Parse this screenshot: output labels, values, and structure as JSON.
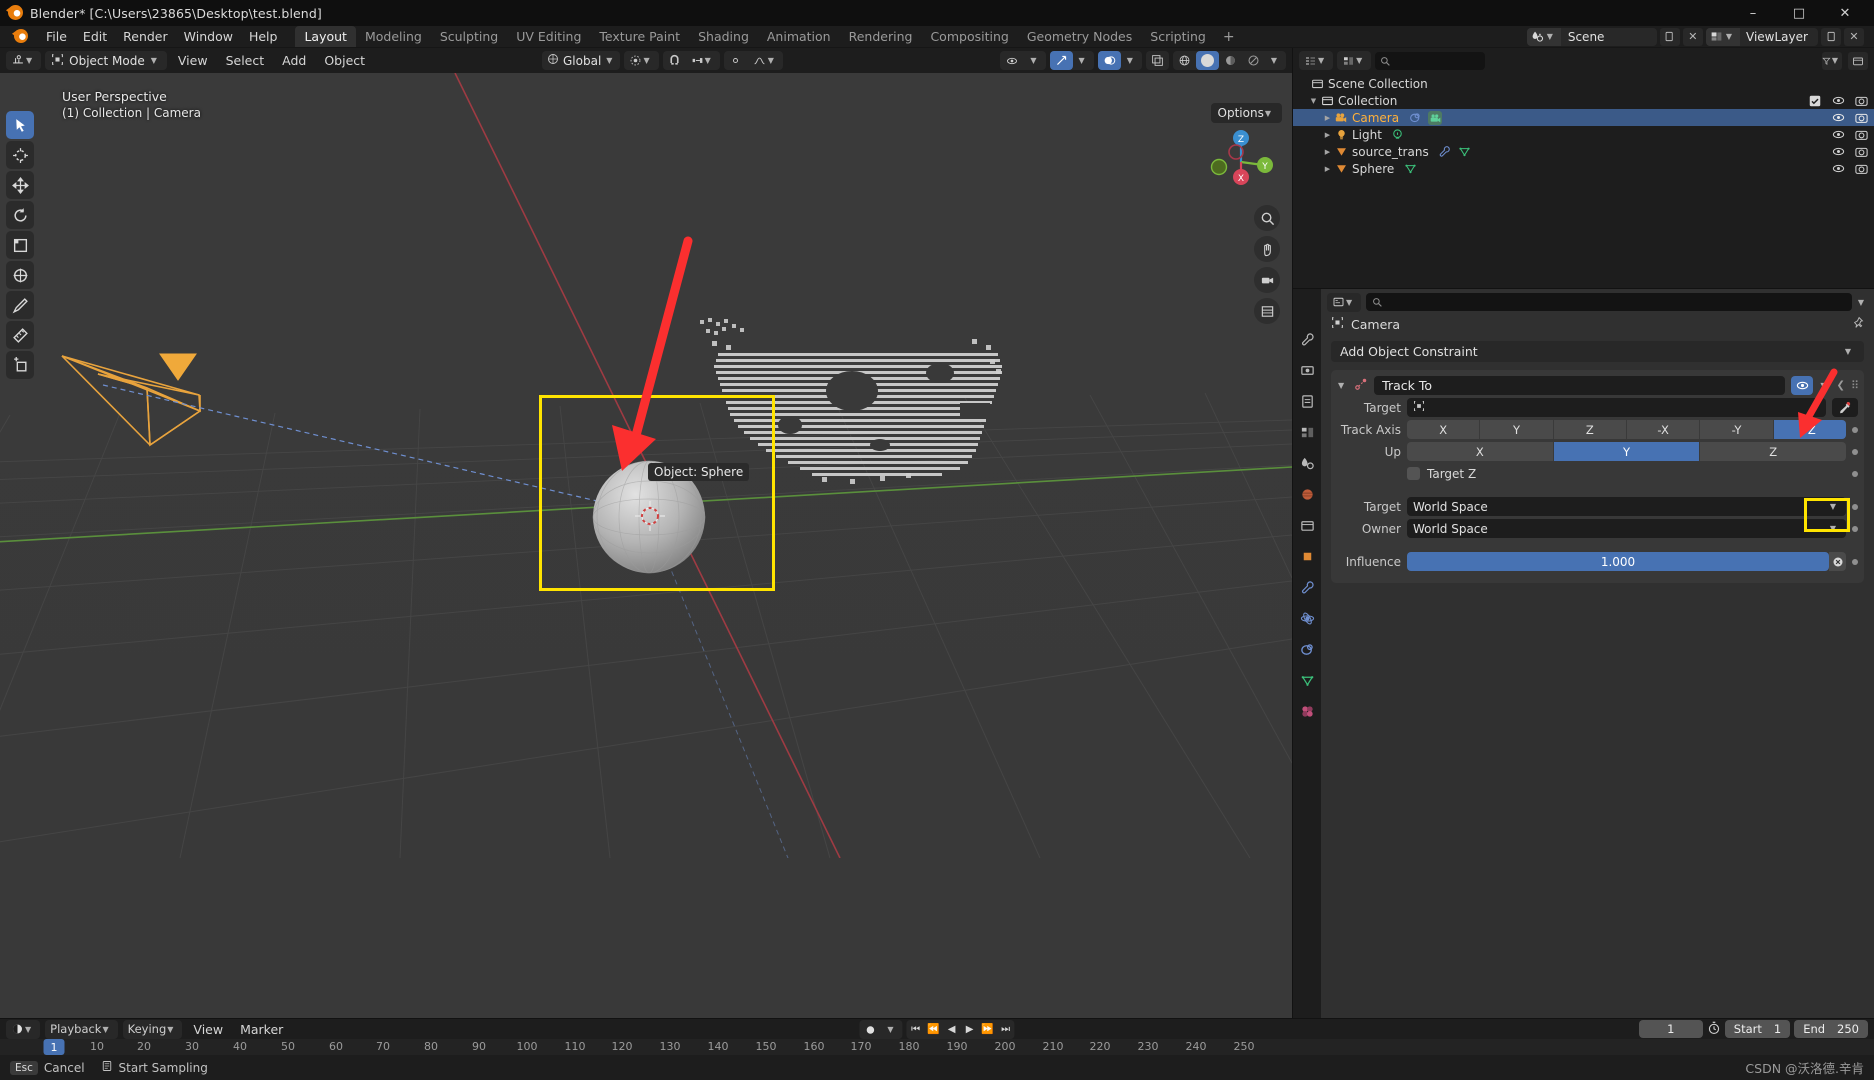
{
  "window": {
    "title": "Blender* [C:\\Users\\23865\\Desktop\\test.blend]",
    "minimize": "–",
    "maximize": "□",
    "close": "✕"
  },
  "menubar": {
    "items": [
      "File",
      "Edit",
      "Render",
      "Window",
      "Help"
    ],
    "tabs": [
      "Layout",
      "Modeling",
      "Sculpting",
      "UV Editing",
      "Texture Paint",
      "Shading",
      "Animation",
      "Rendering",
      "Compositing",
      "Geometry Nodes",
      "Scripting"
    ],
    "active_tab": "Layout",
    "add_tab": "+",
    "scene_name": "Scene",
    "view_layer_name": "ViewLayer"
  },
  "viewport": {
    "mode": "Object Mode",
    "menus": [
      "View",
      "Select",
      "Add",
      "Object"
    ],
    "transform_orientation": "Global",
    "options_label": "Options",
    "overlay_line1": "User Perspective",
    "overlay_line2": "(1) Collection | Camera",
    "object_tooltip": "Object: Sphere",
    "gizmo_axes": [
      "X",
      "Y",
      "Z"
    ],
    "select_modes": [
      "tweak",
      "box",
      "circle",
      "lasso",
      "select"
    ]
  },
  "outliner": {
    "search_placeholder": "",
    "rows": [
      {
        "label": "Scene Collection",
        "indent": 0,
        "icon": "collection-icon",
        "selected": false,
        "has_tri": false,
        "tags": [],
        "show_eye": false,
        "show_camera": false
      },
      {
        "label": "Collection",
        "indent": 1,
        "icon": "collection-icon",
        "selected": false,
        "has_tri": true,
        "tags": [],
        "show_eye": true,
        "show_camera": true,
        "show_check": true
      },
      {
        "label": "Camera",
        "indent": 2,
        "icon": "camera-icon",
        "selected": true,
        "has_tri": true,
        "tags": [
          "constraint-icon",
          "camera-data-icon"
        ],
        "show_eye": true,
        "show_camera": true
      },
      {
        "label": "Light",
        "indent": 2,
        "icon": "light-icon",
        "selected": false,
        "has_tri": true,
        "tags": [
          "light-data-icon"
        ],
        "show_eye": true,
        "show_camera": true
      },
      {
        "label": "source_trans",
        "indent": 2,
        "icon": "mesh-object-icon",
        "selected": false,
        "has_tri": true,
        "tags": [
          "modifier-icon",
          "mesh-data-icon"
        ],
        "show_eye": true,
        "show_camera": true
      },
      {
        "label": "Sphere",
        "indent": 2,
        "icon": "mesh-object-icon",
        "selected": false,
        "has_tri": true,
        "tags": [
          "mesh-data-icon"
        ],
        "show_eye": true,
        "show_camera": true
      }
    ]
  },
  "properties": {
    "breadcrumb_object": "Camera",
    "add_constraint_label": "Add Object Constraint",
    "constraint": {
      "name": "Track To",
      "target_label": "Target",
      "target_value": "",
      "track_axis_label": "Track Axis",
      "track_axis_options": [
        "X",
        "Y",
        "Z",
        "-X",
        "-Y",
        "-Z"
      ],
      "track_axis_active": "-Z",
      "up_label": "Up",
      "up_options": [
        "X",
        "Y",
        "Z"
      ],
      "up_active": "Y",
      "target_z_label": "Target Z",
      "target_space_label": "Target",
      "target_space_value": "World Space",
      "owner_space_label": "Owner",
      "owner_space_value": "World Space",
      "influence_label": "Influence",
      "influence_value": "1.000"
    },
    "tab_icons": [
      "tool-icon",
      "render-icon",
      "output-icon",
      "view-layer-icon",
      "scene-icon",
      "world-icon",
      "collection-props-icon",
      "object-icon",
      "modifier-icon",
      "physics-icon",
      "constraint-icon",
      "data-icon",
      "material-icon"
    ]
  },
  "timeline": {
    "menus": [
      "Playback",
      "Keying",
      "View",
      "Marker"
    ],
    "current_frame": "1",
    "start_label": "Start",
    "start_value": "1",
    "end_label": "End",
    "end_value": "250",
    "playhead_frame": "1",
    "ticks": [
      10,
      20,
      30,
      40,
      50,
      60,
      70,
      80,
      90,
      100,
      110,
      120,
      130,
      140,
      150,
      160,
      170,
      180,
      190,
      200,
      210,
      220,
      230,
      240,
      250
    ]
  },
  "statusbar": {
    "cancel_key": "Esc",
    "cancel_label": "Cancel",
    "action_label": "Start Sampling",
    "watermark": "CSDN @沃洛德.辛肯"
  },
  "colors": {
    "accent_blue": "#4772b3",
    "annotation_red": "#fb2f2f",
    "annotation_yellow": "#ffe400",
    "selected_orange": "#ffb13b",
    "header_dark": "#1d1d1d",
    "viewport_bg": "#393939"
  }
}
